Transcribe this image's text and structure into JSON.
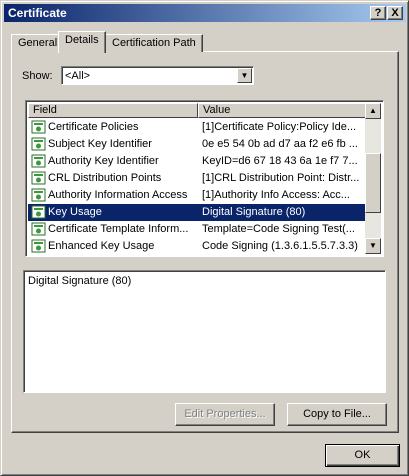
{
  "window": {
    "title": "Certificate"
  },
  "titlebar_buttons": {
    "help": "?",
    "close": "X"
  },
  "tabs": [
    {
      "label": "General"
    },
    {
      "label": "Details"
    },
    {
      "label": "Certification Path"
    }
  ],
  "show": {
    "label": "Show:",
    "selected": "<All>"
  },
  "list": {
    "columns": [
      "Field",
      "Value"
    ],
    "rows": [
      {
        "field": "Certificate Policies",
        "value": "[1]Certificate Policy:Policy Ide..."
      },
      {
        "field": "Subject Key Identifier",
        "value": "0e e5 54 0b ad d7 aa f2 e6 fb ..."
      },
      {
        "field": "Authority Key Identifier",
        "value": "KeyID=d6 67 18 43 6a 1e f7 7..."
      },
      {
        "field": "CRL Distribution Points",
        "value": "[1]CRL Distribution Point: Distr..."
      },
      {
        "field": "Authority Information Access",
        "value": "[1]Authority Info Access: Acc..."
      },
      {
        "field": "Key Usage",
        "value": "Digital Signature (80)",
        "selected": true
      },
      {
        "field": "Certificate Template Inform...",
        "value": "Template=Code Signing Test(..."
      },
      {
        "field": "Enhanced Key Usage",
        "value": "Code Signing (1.3.6.1.5.5.7.3.3)"
      }
    ]
  },
  "detail": {
    "text": "Digital Signature (80)"
  },
  "buttons": {
    "edit_properties": "Edit Properties...",
    "copy_to_file": "Copy to File...",
    "ok": "OK"
  }
}
